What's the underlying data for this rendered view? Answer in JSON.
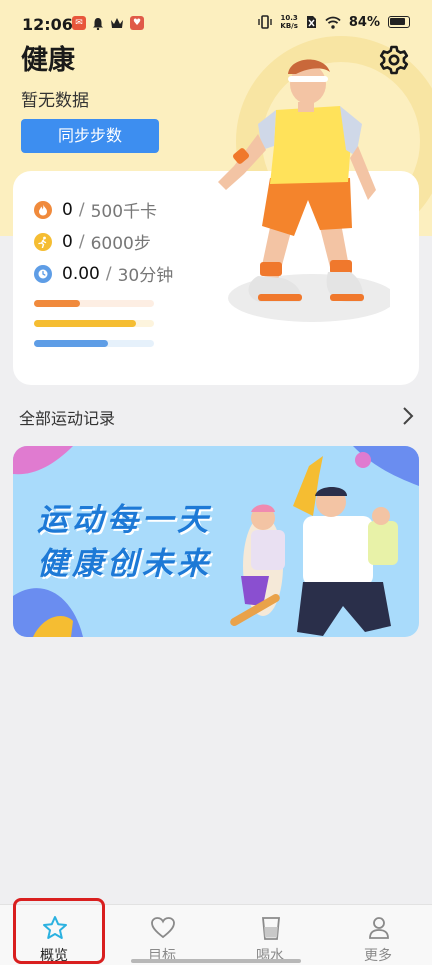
{
  "status_bar": {
    "time": "12:06",
    "net_speed_value": "10.3",
    "net_speed_unit": "KB/s",
    "battery": "84%"
  },
  "header": {
    "title": "健康",
    "subtitle": "暂无数据",
    "sync_button": "同步步数"
  },
  "stats": [
    {
      "value": "0",
      "separator": "/",
      "goal": "500千卡",
      "icon": "flame-icon",
      "color": "#f08a3c"
    },
    {
      "value": "0",
      "separator": "/",
      "goal": "6000步",
      "icon": "running-icon",
      "color": "#f5bd32"
    },
    {
      "value": "0.00",
      "separator": "/",
      "goal": "30分钟",
      "icon": "clock-icon",
      "color": "#5e9de6"
    }
  ],
  "progress": [
    {
      "color": "#f08a3c",
      "track": "#fdeee3",
      "fraction": 0.38
    },
    {
      "color": "#f5bd32",
      "track": "#fdf4dd",
      "fraction": 0.85
    },
    {
      "color": "#5e9de6",
      "track": "#e6f1fb",
      "fraction": 0.62
    }
  ],
  "records": {
    "label": "全部运动记录"
  },
  "banner": {
    "line1": "运动每一天",
    "line2": "健康创未来"
  },
  "tabs": [
    {
      "label": "概览",
      "icon": "star-icon",
      "active": true
    },
    {
      "label": "目标",
      "icon": "heart-icon",
      "active": false
    },
    {
      "label": "喝水",
      "icon": "cup-icon",
      "active": false
    },
    {
      "label": "更多",
      "icon": "person-icon",
      "active": false
    }
  ],
  "colors": {
    "accent": "#3d8ef0",
    "active_tab": "#2bb1e0",
    "highlight": "#d91f1f"
  }
}
